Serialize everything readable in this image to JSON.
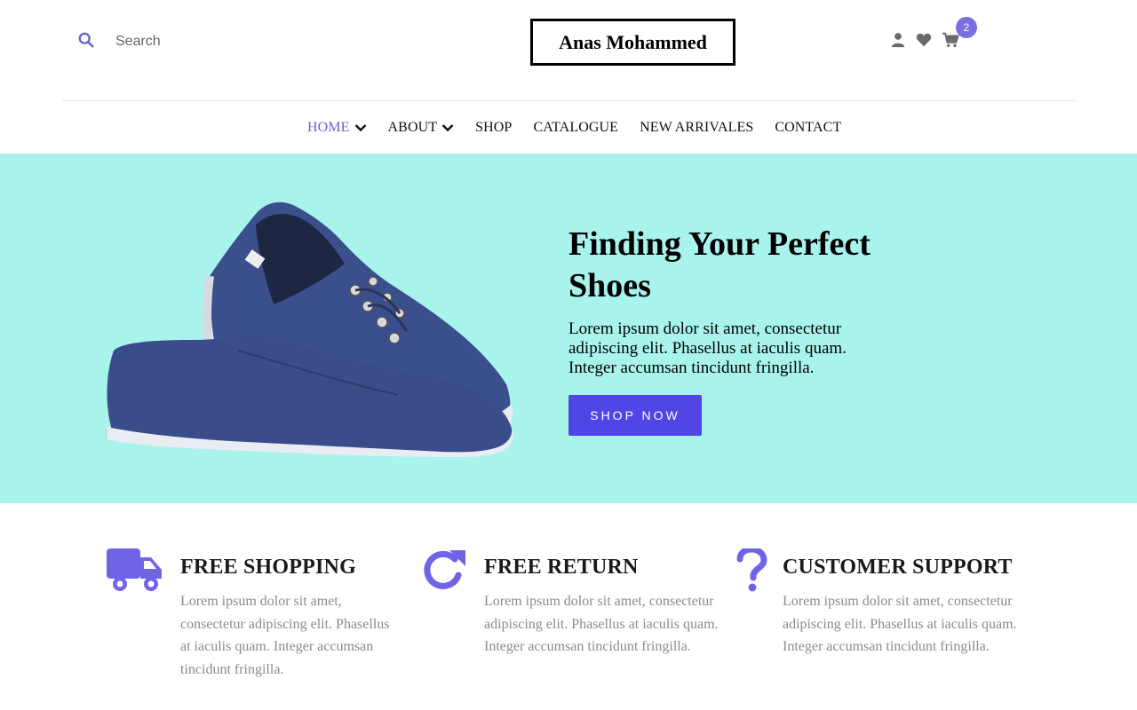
{
  "header": {
    "search": {
      "placeholder": "Search",
      "value": ""
    },
    "logo": "Anas Mohammed",
    "cart_count": "2",
    "icons": [
      "search-icon",
      "user-icon",
      "heart-icon",
      "cart-icon"
    ]
  },
  "nav": {
    "items": [
      {
        "label": "HOME",
        "has_dropdown": true,
        "active": true
      },
      {
        "label": "ABOUT",
        "has_dropdown": true,
        "active": false
      },
      {
        "label": "SHOP",
        "has_dropdown": false,
        "active": false
      },
      {
        "label": "CATALOGUE",
        "has_dropdown": false,
        "active": false
      },
      {
        "label": "NEW ARRIVALES",
        "has_dropdown": false,
        "active": false
      },
      {
        "label": "CONTACT",
        "has_dropdown": false,
        "active": false
      }
    ]
  },
  "hero": {
    "title": "Finding Your Perfect Shoes",
    "text": "Lorem ipsum dolor sit amet, consectetur adipiscing elit. Phasellus at iaculis quam. Integer accumsan tincidunt fringilla.",
    "button": "SHOP NOW",
    "image": "blue-canvas-sneakers-image"
  },
  "features": [
    {
      "icon": "truck-icon",
      "title": "FREE SHOPPING",
      "text": "Lorem ipsum dolor sit amet, consectetur adipiscing elit. Phasellus at iaculis quam. Integer accumsan tincidunt fringilla."
    },
    {
      "icon": "refresh-icon",
      "title": "FREE RETURN",
      "text": "Lorem ipsum dolor sit amet, consectetur adipiscing elit. Phasellus at iaculis quam. Integer accumsan tincidunt fringilla."
    },
    {
      "icon": "question-icon",
      "title": "CUSTOMER SUPPORT",
      "text": "Lorem ipsum dolor sit amet, consectetur adipiscing elit. Phasellus at iaculis quam. Integer accumsan tincidunt fringilla."
    }
  ],
  "colors": {
    "accent": "#4f46e5",
    "accent_light": "#7b6ee0",
    "hero_bg": "#a8f3ec",
    "muted_text": "#8a8a8a"
  }
}
